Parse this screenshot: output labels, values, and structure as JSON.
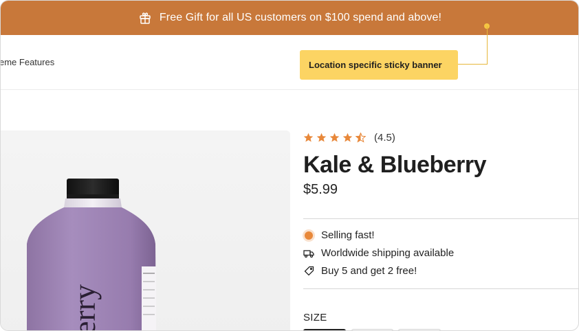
{
  "banner": {
    "icon": "gift-icon",
    "text": "Free Gift for all US customers on $100 spend and above!",
    "background": "#c8783a"
  },
  "nav": {
    "partial_link": "eme Features"
  },
  "callout": {
    "text": "Location specific sticky banner",
    "background": "#fcd463"
  },
  "product": {
    "rating": {
      "stars": 4.5,
      "max": 5,
      "label": "(4.5)",
      "color": "#e8883a"
    },
    "title": "Kale & Blueberry",
    "price": "$5.99",
    "bottle_label_text": "erry",
    "features": [
      {
        "icon": "selling-fast-pulse-icon",
        "text": "Selling fast!"
      },
      {
        "icon": "truck-icon",
        "text": "Worldwide shipping available"
      },
      {
        "icon": "tag-icon",
        "text": "Buy 5 and get 2 free!"
      }
    ],
    "size_label": "SIZE"
  }
}
